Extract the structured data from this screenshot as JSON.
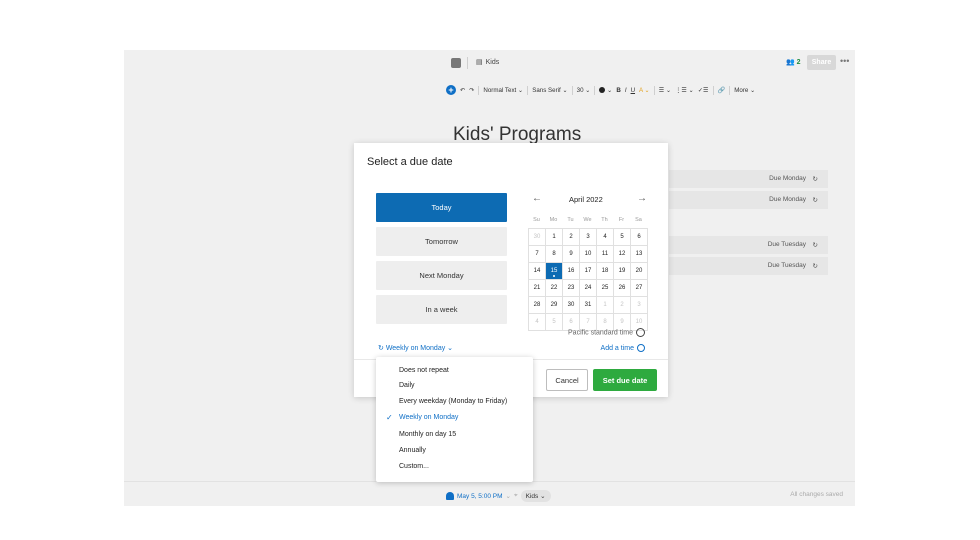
{
  "topbar": {
    "doc_title": "Kids",
    "shared_count": "2",
    "share_label": "Share",
    "more_label": "•••",
    "note_icon": "note-icon",
    "notebook_icon": "book-icon"
  },
  "toolbar": {
    "add": "+",
    "undo": "↶",
    "redo": "↷",
    "style": "Normal Text ⌄",
    "font": "Sans Serif ⌄",
    "size": "30 ⌄",
    "color_caret": "⌄",
    "bold": "B",
    "italic": "I",
    "underline": "U",
    "highlight": "A ⌄",
    "bullet_list": "☰ ⌄",
    "numbered_list": "⋮☰ ⌄",
    "checklist": "✓☰",
    "link": "🔗",
    "more": "More ⌄"
  },
  "document": {
    "heading": "Kids' Programs",
    "tasks": [
      {
        "due": "Due Monday",
        "icon": "repeat-icon"
      },
      {
        "due": "Due Monday",
        "icon": "repeat-icon"
      },
      {
        "due": "Due Tuesday",
        "icon": "repeat-icon"
      },
      {
        "due": "Due Tuesday",
        "icon": "repeat-icon"
      }
    ]
  },
  "footer": {
    "reminder": "May 5, 5:00 PM",
    "reminder_caret": "⌄",
    "tag": "Kids",
    "tag_caret": "⌄",
    "status": "All changes saved"
  },
  "modal": {
    "title": "Select a due date",
    "quick_options": [
      "Today",
      "Tomorrow",
      "Next Monday",
      "In a week"
    ],
    "selected_quick": 0,
    "calendar": {
      "prev": "←",
      "next": "→",
      "month": "April 2022",
      "weekdays": [
        "Su",
        "Mo",
        "Tu",
        "We",
        "Th",
        "Fr",
        "Sa"
      ],
      "weeks": [
        [
          "30",
          "1",
          "2",
          "3",
          "4",
          "5",
          "6"
        ],
        [
          "7",
          "8",
          "9",
          "10",
          "11",
          "12",
          "13"
        ],
        [
          "14",
          "15",
          "16",
          "17",
          "18",
          "19",
          "20"
        ],
        [
          "21",
          "22",
          "23",
          "24",
          "25",
          "26",
          "27"
        ],
        [
          "28",
          "29",
          "30",
          "31",
          "1",
          "2",
          "3"
        ],
        [
          "4",
          "5",
          "6",
          "7",
          "8",
          "9",
          "10"
        ]
      ],
      "selected_day": "15"
    },
    "timezone": "Pacific standard time",
    "add_time": "Add a time",
    "repeat_label": "Weekly on Monday",
    "repeat_caret": "⌄",
    "cancel": "Cancel",
    "submit": "Set due date"
  },
  "repeat_menu": {
    "items": [
      "Does not repeat",
      "Daily",
      "Every weekday (Monday to Friday)",
      "Weekly on Monday",
      "Monthly on day 15",
      "Annually",
      "Custom..."
    ],
    "selected": 3,
    "check": "✓"
  },
  "colors": {
    "primary": "#0d6bb3",
    "accent_green": "#2eaa3f",
    "link_blue": "#0f6fc6",
    "backdrop": "#f0f0f0"
  }
}
